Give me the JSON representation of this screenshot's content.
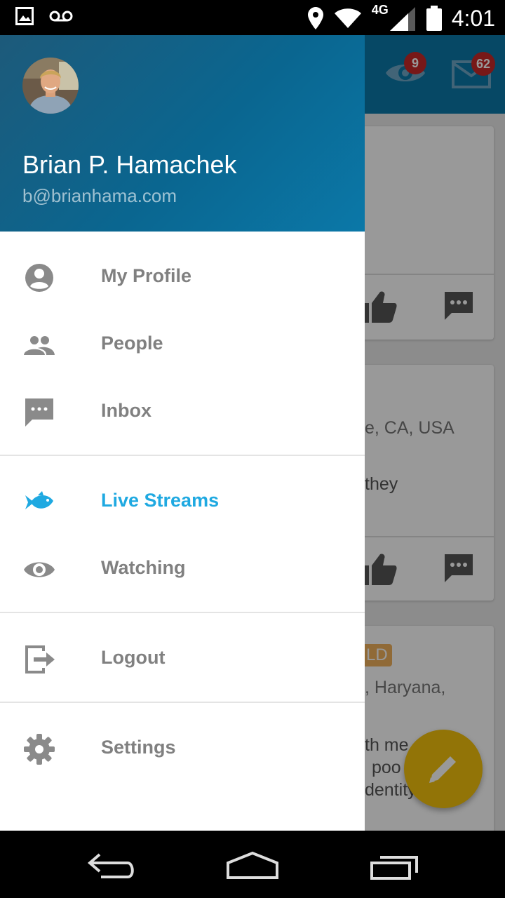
{
  "status_bar": {
    "time": "4:01",
    "network": "4G",
    "icons": [
      "image-icon",
      "voicemail-icon",
      "location-icon",
      "wifi-icon",
      "cell-signal-icon",
      "battery-icon"
    ]
  },
  "app_bar": {
    "watch_badge": "9",
    "mail_badge": "62"
  },
  "background_cards": {
    "card2_location": "e, CA, USA",
    "card2_text": "they",
    "card3_tag": "LD",
    "card3_location": ", Haryana,",
    "card3_line1": "th me",
    "card3_line2": "poo",
    "card3_line3": "dentity"
  },
  "drawer": {
    "user_name": "Brian P. Hamachek",
    "user_email": "b@brianhama.com",
    "menu": [
      {
        "label": "My Profile",
        "icon": "account-circle-icon"
      },
      {
        "label": "People",
        "icon": "people-icon"
      },
      {
        "label": "Inbox",
        "icon": "message-icon"
      },
      {
        "label": "Live Streams",
        "icon": "fish-icon",
        "active": true
      },
      {
        "label": "Watching",
        "icon": "eye-icon"
      },
      {
        "label": "Logout",
        "icon": "logout-icon"
      },
      {
        "label": "Settings",
        "icon": "gear-icon"
      }
    ]
  },
  "colors": {
    "accent": "#1fa9e1",
    "header": "#0b79a8",
    "menu_text": "#808080",
    "fab": "#f4c20d",
    "badge": "#c62828"
  }
}
